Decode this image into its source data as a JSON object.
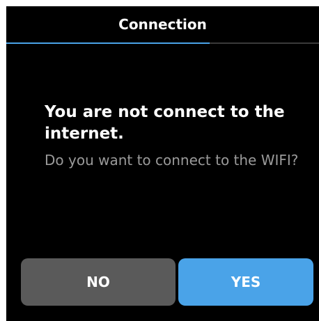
{
  "header": {
    "title": "Connection"
  },
  "progress": {
    "value": 0.65
  },
  "message": {
    "title": "You are not connect to the internet.",
    "subtitle": "Do you want to connect to the WIFI?"
  },
  "buttons": {
    "no_label": "NO",
    "yes_label": "YES"
  },
  "colors": {
    "background": "#000000",
    "accent": "#4aa3e8",
    "secondary_button": "#5a5a5a",
    "subtitle_text": "#9a9a9a"
  }
}
